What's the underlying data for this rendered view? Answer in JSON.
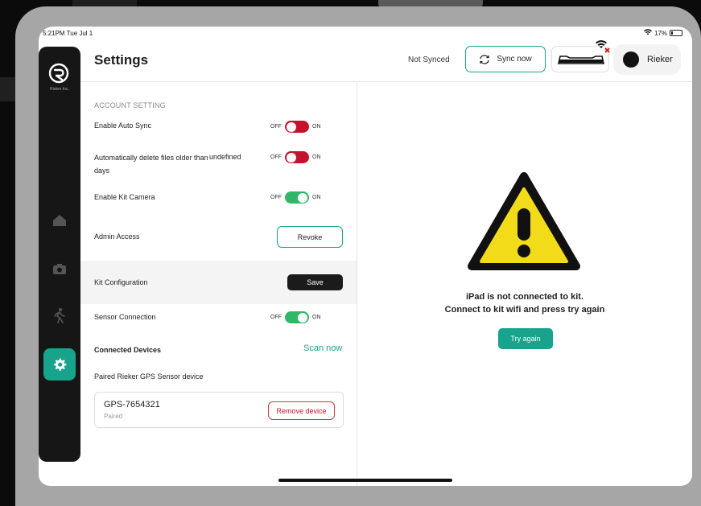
{
  "status_bar": {
    "time": "5:21PM  Tue Jul 1",
    "battery": "17%"
  },
  "sidebar": {
    "logo_text": "Rieker Inc."
  },
  "header": {
    "title": "Settings",
    "sync_status": "Not Synced",
    "sync_button": "Sync now",
    "user_name": "Rieker"
  },
  "settings": {
    "section_title": "ACCOUNT SETTING",
    "auto_sync": {
      "label": "Enable Auto Sync",
      "off": "OFF",
      "on": "ON",
      "state": "off"
    },
    "auto_delete": {
      "label_line1": "Automatically delete files older than",
      "label_line2": "days",
      "value": "undefined",
      "off": "OFF",
      "on": "ON",
      "state": "off"
    },
    "kit_camera": {
      "label": "Enable Kit Camera",
      "off": "OFF",
      "on": "ON",
      "state": "on"
    },
    "admin_access": {
      "label": "Admin Access",
      "button": "Revoke"
    },
    "kit_configuration": {
      "label": "Kit Configuration",
      "button": "Save"
    },
    "sensor_connection": {
      "label": "Sensor Connection",
      "off": "OFF",
      "on": "ON",
      "state": "on"
    },
    "connected_devices": {
      "label": "Connected Devices",
      "action": "Scan now"
    },
    "paired_label": "Paired Rieker GPS Sensor device",
    "device": {
      "name": "GPS-7654321",
      "status": "Paired",
      "button": "Remove device"
    }
  },
  "connection_panel": {
    "message_line1": "iPad is not connected to kit.",
    "message_line2": "Connect to kit wifi and press try again",
    "button": "Try again"
  },
  "colors": {
    "accent": "#17a38c",
    "toggle_off": "#c4132e",
    "toggle_on": "#2fb865",
    "warning": "#f2dc1a"
  }
}
